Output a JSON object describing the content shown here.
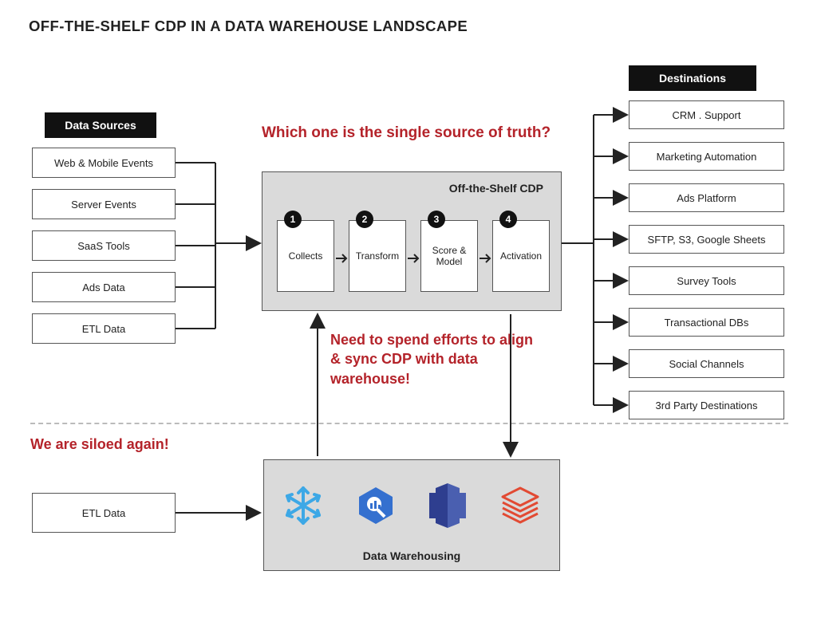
{
  "title": "OFF-THE-SHELF CDP IN A DATA WAREHOUSE LANDSCAPE",
  "sections": {
    "sources": "Data Sources",
    "destinations": "Destinations"
  },
  "sources": [
    "Web & Mobile Events",
    "Server Events",
    "SaaS Tools",
    "Ads Data",
    "ETL Data"
  ],
  "destinations": [
    "CRM . Support",
    "Marketing Automation",
    "Ads Platform",
    "SFTP, S3, Google Sheets",
    "Survey Tools",
    "Transactional DBs",
    "Social Channels",
    "3rd Party Destinations"
  ],
  "cdp": {
    "label": "Off-the-Shelf CDP",
    "steps": [
      {
        "num": "1",
        "label": "Collects"
      },
      {
        "num": "2",
        "label": "Transform"
      },
      {
        "num": "3",
        "label": "Score & Model"
      },
      {
        "num": "4",
        "label": "Activation"
      }
    ]
  },
  "callouts": {
    "truth": "Which one is the single source of truth?",
    "sync": "Need to spend efforts to align & sync CDP with data warehouse!",
    "siloed": "We are siloed again!"
  },
  "warehouse": {
    "label": "Data Warehousing",
    "etl_box": "ETL Data",
    "icons": [
      "snowflake-icon",
      "bigquery-icon",
      "redshift-icon",
      "databricks-icon"
    ]
  }
}
